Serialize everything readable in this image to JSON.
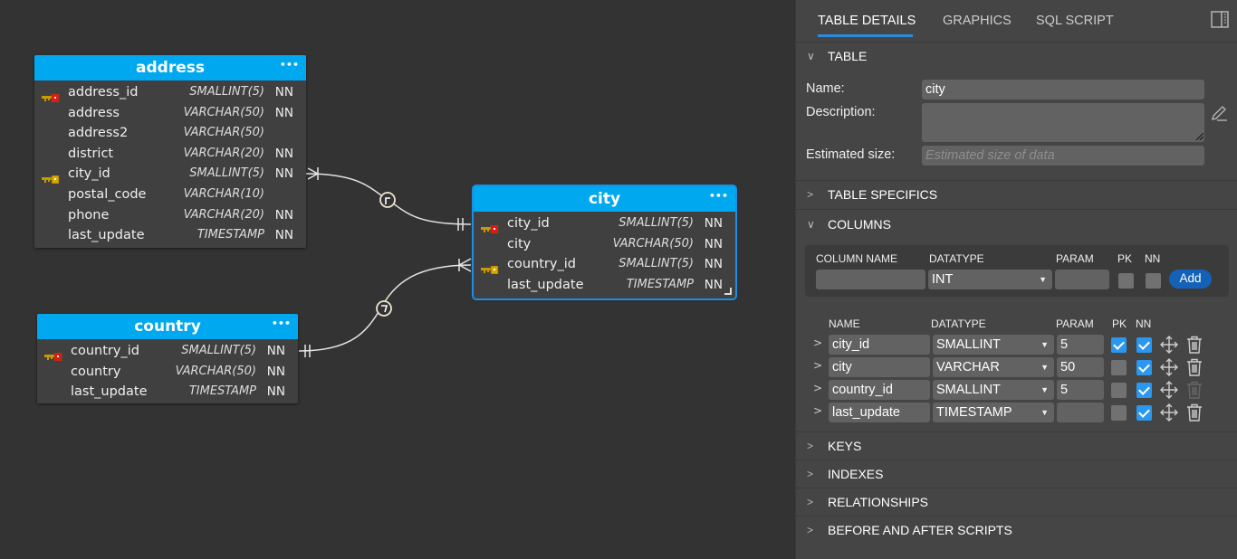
{
  "colors": {
    "canvas_bg": "#333333",
    "table_header": "#00a8f0",
    "selected_outline": "#1a8fe3",
    "panel_bg": "#454545",
    "checkbox_on": "#2a97f0",
    "add_button": "#1462b8",
    "tab_underline": "#2a8be0"
  },
  "diagram": {
    "tables": [
      {
        "name": "address",
        "menu_icon": "more-dots-icon",
        "selected": false,
        "columns": [
          {
            "name": "address_id",
            "type": "SMALLINT(5)",
            "nn": "NN",
            "key": "primary-key-icon"
          },
          {
            "name": "address",
            "type": "VARCHAR(50)",
            "nn": "NN",
            "key": ""
          },
          {
            "name": "address2",
            "type": "VARCHAR(50)",
            "nn": "",
            "key": ""
          },
          {
            "name": "district",
            "type": "VARCHAR(20)",
            "nn": "NN",
            "key": ""
          },
          {
            "name": "city_id",
            "type": "SMALLINT(5)",
            "nn": "NN",
            "key": "foreign-key-icon"
          },
          {
            "name": "postal_code",
            "type": "VARCHAR(10)",
            "nn": "",
            "key": ""
          },
          {
            "name": "phone",
            "type": "VARCHAR(20)",
            "nn": "NN",
            "key": ""
          },
          {
            "name": "last_update",
            "type": "TIMESTAMP",
            "nn": "NN",
            "key": ""
          }
        ]
      },
      {
        "name": "city",
        "menu_icon": "more-dots-icon",
        "selected": true,
        "columns": [
          {
            "name": "city_id",
            "type": "SMALLINT(5)",
            "nn": "NN",
            "key": "primary-key-icon"
          },
          {
            "name": "city",
            "type": "VARCHAR(50)",
            "nn": "NN",
            "key": ""
          },
          {
            "name": "country_id",
            "type": "SMALLINT(5)",
            "nn": "NN",
            "key": "foreign-key-icon"
          },
          {
            "name": "last_update",
            "type": "TIMESTAMP",
            "nn": "NN",
            "key": ""
          }
        ]
      },
      {
        "name": "country",
        "menu_icon": "more-dots-icon",
        "selected": false,
        "columns": [
          {
            "name": "country_id",
            "type": "SMALLINT(5)",
            "nn": "NN",
            "key": "primary-key-icon"
          },
          {
            "name": "country",
            "type": "VARCHAR(50)",
            "nn": "NN",
            "key": ""
          },
          {
            "name": "last_update",
            "type": "TIMESTAMP",
            "nn": "NN",
            "key": ""
          }
        ]
      }
    ],
    "relationships": [
      {
        "from": "city",
        "to": "address",
        "from_cardinality": "one-and-only-one",
        "to_cardinality": "one-or-many"
      },
      {
        "from": "country",
        "to": "city",
        "from_cardinality": "one-and-only-one",
        "to_cardinality": "one-or-many"
      }
    ]
  },
  "panel": {
    "tabs": [
      {
        "label": "TABLE DETAILS",
        "active": true
      },
      {
        "label": "GRAPHICS",
        "active": false
      },
      {
        "label": "SQL SCRIPT",
        "active": false
      }
    ],
    "layout_toggle_icon": "panel-layout-icon",
    "table_section": {
      "title": "TABLE",
      "expanded": true,
      "name_label": "Name:",
      "name_value": "city",
      "description_label": "Description:",
      "description_value": "",
      "estimated_size_label": "Estimated size:",
      "estimated_size_placeholder": "Estimated size of data"
    },
    "table_specifics": {
      "title": "TABLE SPECIFICS",
      "expanded": false
    },
    "columns_section": {
      "title": "COLUMNS",
      "expanded": true,
      "new_column": {
        "headers": {
          "name": "COLUMN NAME",
          "datatype": "DATATYPE",
          "param": "PARAM",
          "pk": "PK",
          "nn": "NN"
        },
        "name_value": "",
        "datatype_value": "INT",
        "param_value": "",
        "pk": false,
        "nn": false,
        "add_label": "Add"
      },
      "list_headers": {
        "name": "NAME",
        "datatype": "DATATYPE",
        "param": "PARAM",
        "pk": "PK",
        "nn": "NN"
      },
      "rows": [
        {
          "name": "city_id",
          "datatype": "SMALLINT",
          "param": "5",
          "pk": true,
          "nn": true,
          "delete_enabled": true
        },
        {
          "name": "city",
          "datatype": "VARCHAR",
          "param": "50",
          "pk": false,
          "nn": true,
          "delete_enabled": true
        },
        {
          "name": "country_id",
          "datatype": "SMALLINT",
          "param": "5",
          "pk": false,
          "nn": true,
          "delete_enabled": false
        },
        {
          "name": "last_update",
          "datatype": "TIMESTAMP",
          "param": "",
          "pk": false,
          "nn": true,
          "delete_enabled": true
        }
      ]
    },
    "collapsed_sections": [
      {
        "title": "KEYS"
      },
      {
        "title": "INDEXES"
      },
      {
        "title": "RELATIONSHIPS"
      },
      {
        "title": "BEFORE AND AFTER SCRIPTS"
      }
    ]
  }
}
